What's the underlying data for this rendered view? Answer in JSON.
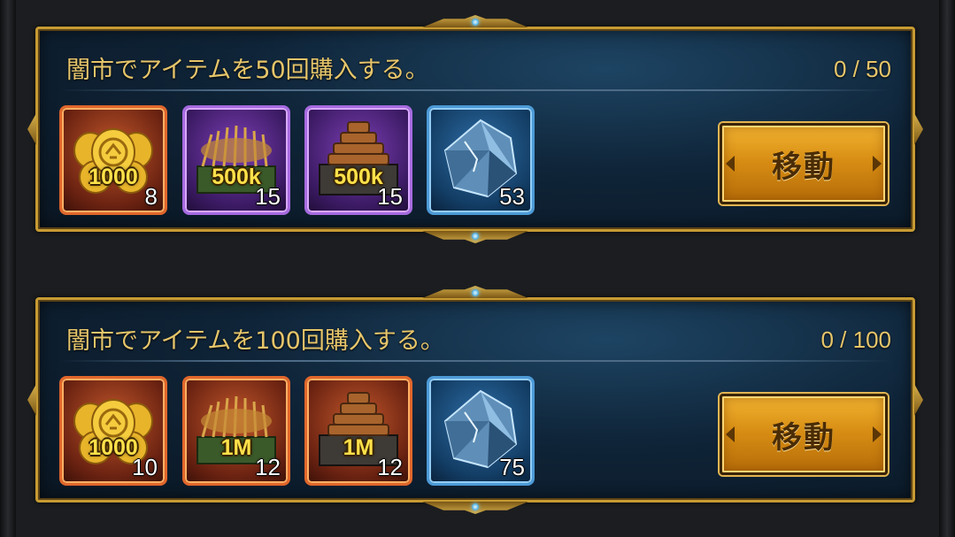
{
  "quests": [
    {
      "title": "闇市でアイテムを50回購入する。",
      "progress": "0 / 50",
      "button_label": "移動",
      "rewards": [
        {
          "icon": "gold-coins-icon",
          "rarity": "orange",
          "amount": "1000",
          "count": "8"
        },
        {
          "icon": "food-wheat-icon",
          "rarity": "purple",
          "amount": "500k",
          "count": "15"
        },
        {
          "icon": "wood-lumber-icon",
          "rarity": "purple",
          "amount": "500k",
          "count": "15"
        },
        {
          "icon": "blue-crystal-icon",
          "rarity": "blue",
          "amount": "",
          "count": "53"
        }
      ]
    },
    {
      "title": "闇市でアイテムを100回購入する。",
      "progress": "0 / 100",
      "button_label": "移動",
      "rewards": [
        {
          "icon": "gold-coins-icon",
          "rarity": "orange",
          "amount": "1000",
          "count": "10"
        },
        {
          "icon": "food-wheat-icon",
          "rarity": "orange",
          "amount": "1M",
          "count": "12"
        },
        {
          "icon": "wood-lumber-icon",
          "rarity": "orange",
          "amount": "1M",
          "count": "12"
        },
        {
          "icon": "blue-crystal-icon",
          "rarity": "blue",
          "amount": "",
          "count": "75"
        }
      ]
    }
  ],
  "colors": {
    "panel_border": "#c79b32",
    "title_text": "#e6c56a",
    "button_fill": "#d88e14",
    "rarity_orange": "#e0662b",
    "rarity_purple": "#a66ae0",
    "rarity_blue": "#4c9ad6"
  }
}
